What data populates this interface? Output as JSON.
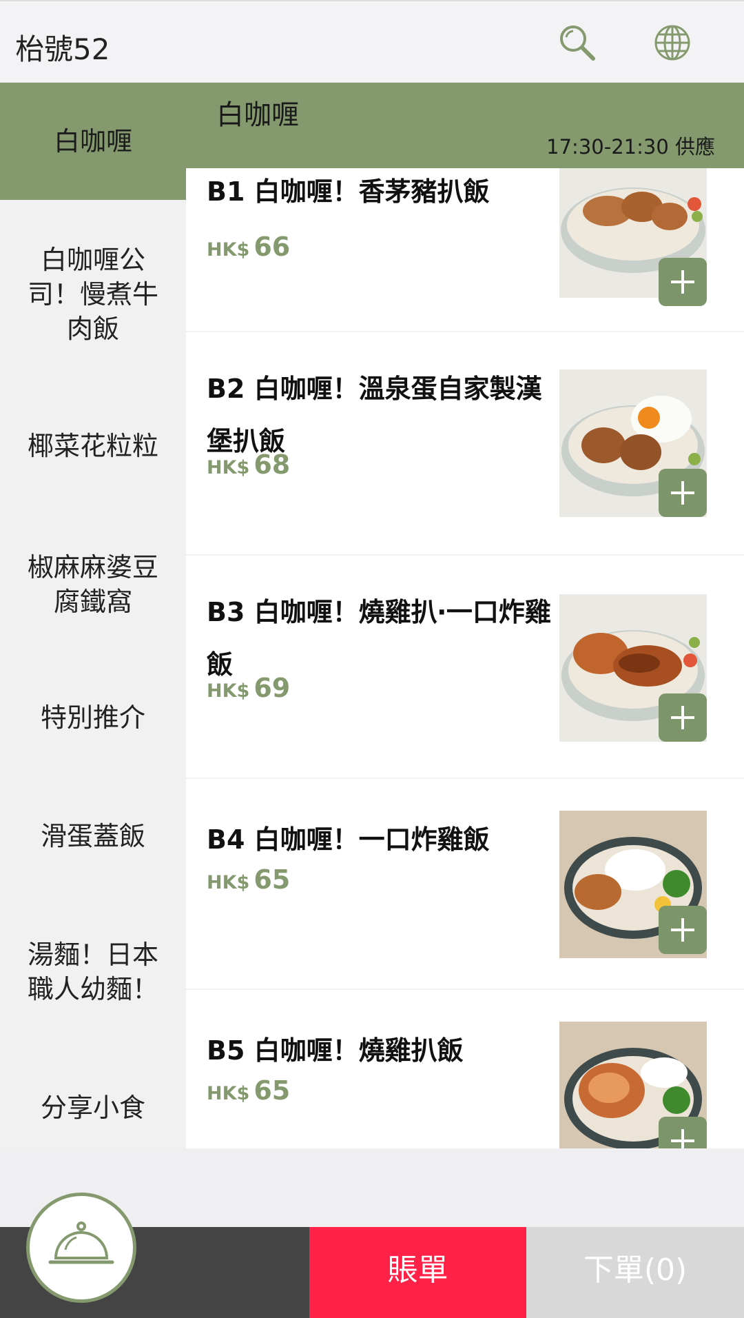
{
  "header": {
    "table_label": "枱號52",
    "search_icon": "search-icon",
    "language_icon": "globe-icon"
  },
  "sidebar": {
    "items": [
      {
        "label": "白咖喱",
        "active": true
      },
      {
        "label": "白咖喱公司！慢煮牛肉飯",
        "active": false
      },
      {
        "label": "椰菜花粒粒",
        "active": false
      },
      {
        "label": "椒麻麻婆豆腐鐵窩",
        "active": false
      },
      {
        "label": "特別推介",
        "active": false
      },
      {
        "label": "滑蛋蓋飯",
        "active": false
      },
      {
        "label": "湯麵！日本職人幼麵！",
        "active": false
      },
      {
        "label": "分享小食",
        "active": false
      }
    ]
  },
  "category": {
    "title": "白咖喱",
    "hours": "17:30-21:30 供應"
  },
  "menu": {
    "currency": "HK$",
    "items": [
      {
        "name": "B1 白咖喱！香茅豬扒飯",
        "price": "66"
      },
      {
        "name": "B2 白咖喱！溫泉蛋自家製漢堡扒飯",
        "price": "68"
      },
      {
        "name": "B3 白咖喱！燒雞扒‧一口炸雞飯",
        "price": "69"
      },
      {
        "name": "B4 白咖喱！一口炸雞飯",
        "price": "65"
      },
      {
        "name": "B5 白咖喱！燒雞扒飯",
        "price": "65"
      }
    ]
  },
  "footer": {
    "cart_icon": "cloche-icon",
    "bill_label": "賬單",
    "order_label": "下單(0)"
  },
  "colors": {
    "accent_green": "#849a6e",
    "bill_red": "#ff2147",
    "bar_dark": "#444444",
    "order_gray": "#d8d8d8"
  }
}
